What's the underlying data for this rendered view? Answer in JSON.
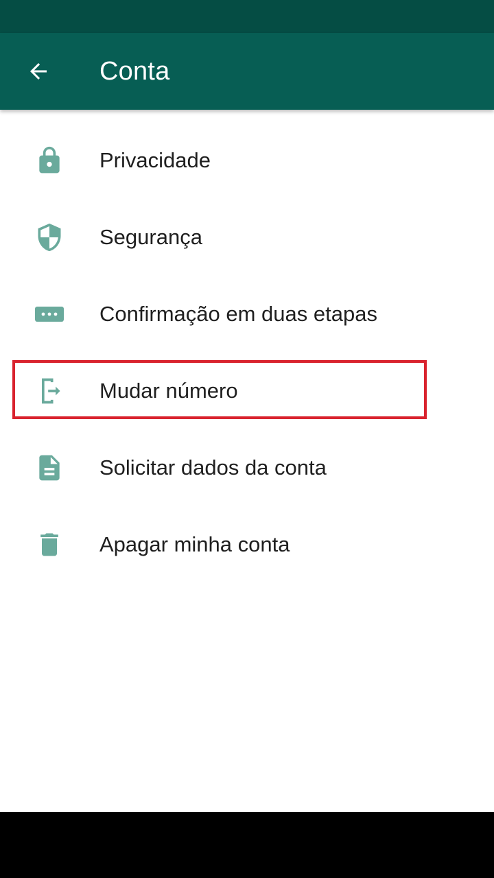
{
  "app_bar": {
    "title": "Conta",
    "back_icon": "arrow-left-icon",
    "background_color": "#075e54",
    "status_bar_color": "#054d44"
  },
  "menu": {
    "icon_color": "#6aaa9c",
    "items": [
      {
        "label": "Privacidade",
        "icon": "lock-icon"
      },
      {
        "label": "Segurança",
        "icon": "shield-icon"
      },
      {
        "label": "Confirmação em duas etapas",
        "icon": "dots-password-icon"
      },
      {
        "label": "Mudar número",
        "icon": "change-number-icon",
        "highlighted": true
      },
      {
        "label": "Solicitar dados da conta",
        "icon": "document-icon"
      },
      {
        "label": "Apagar minha conta",
        "icon": "trash-icon"
      }
    ]
  },
  "highlight_color": "#d9232e"
}
